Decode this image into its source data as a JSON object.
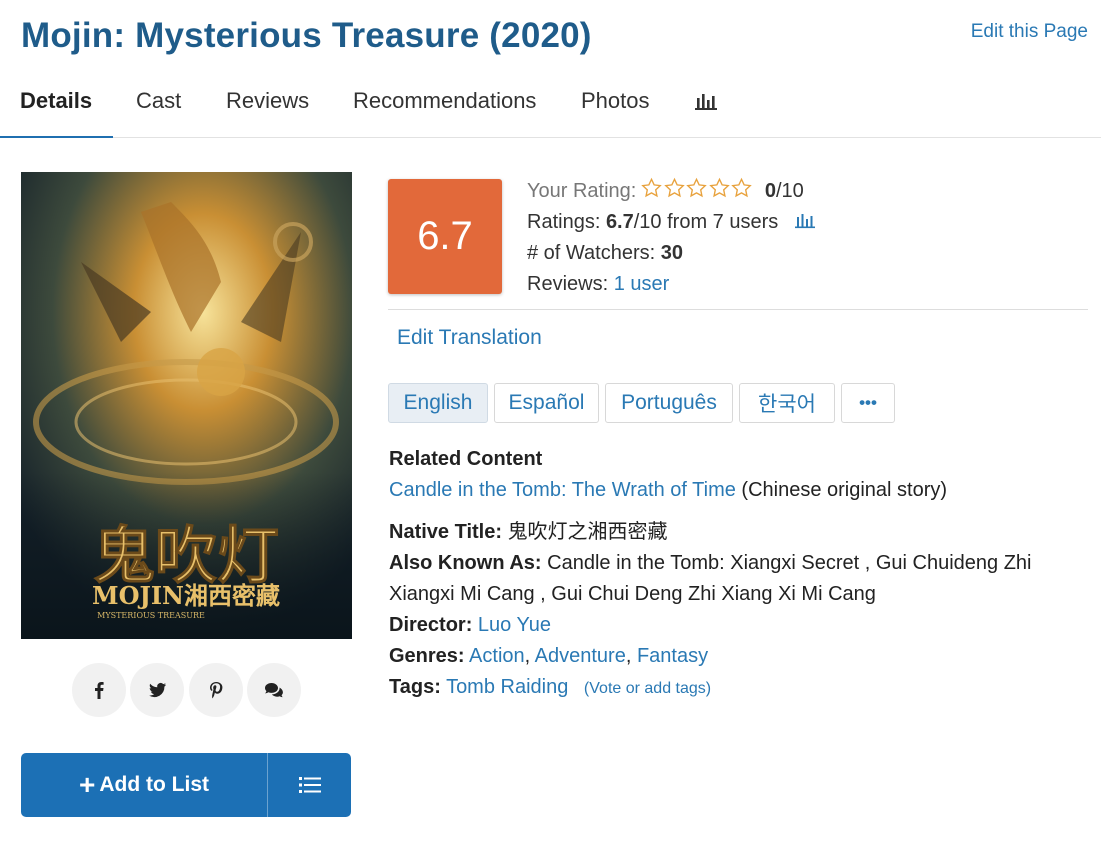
{
  "header": {
    "title": "Mojin: Mysterious Treasure (2020)",
    "edit_page": "Edit this Page"
  },
  "tabs": [
    {
      "label": "Details",
      "active": true
    },
    {
      "label": "Cast"
    },
    {
      "label": "Reviews"
    },
    {
      "label": "Recommendations"
    },
    {
      "label": "Photos"
    }
  ],
  "tabs_extra_icon": "bar-chart-icon",
  "poster": {
    "text_main": "鬼吹灯",
    "text_sub": "MOJIN湘西密藏",
    "text_small": "MYSTERIOUS TREASURE"
  },
  "share_icons": [
    "facebook-icon",
    "twitter-icon",
    "pinterest-icon",
    "comments-icon"
  ],
  "add_list": {
    "label": "Add to List",
    "icon": "list-icon"
  },
  "score": "6.7",
  "rating": {
    "your_label": "Your Rating:",
    "your_value": "0",
    "your_max": "/10",
    "stars_count": 5,
    "ratings_label": "Ratings:",
    "ratings_value": "6.7",
    "ratings_suffix": "/10 from 7 users",
    "watchers_label": "# of Watchers:",
    "watchers_value": "30",
    "reviews_label": "Reviews:",
    "reviews_value": "1 user"
  },
  "edit_translation": "Edit Translation",
  "languages": [
    {
      "label": "English",
      "active": true
    },
    {
      "label": "Español"
    },
    {
      "label": "Português"
    },
    {
      "label": "한국어"
    },
    {
      "label": "•••"
    }
  ],
  "details": {
    "related_label": "Related Content",
    "related_link": "Candle in the Tomb: The Wrath of Time",
    "related_note": "(Chinese original story)",
    "native_label": "Native Title:",
    "native_value": "鬼吹灯之湘西密藏",
    "aka_label": "Also Known As:",
    "aka_line1": "Candle in the Tomb: Xiangxi Secret , Gui Chuideng Zhi",
    "aka_line2": "Xiangxi Mi Cang , Gui Chui Deng Zhi Xiang Xi Mi Cang",
    "director_label": "Director:",
    "director_value": "Luo Yue",
    "genres_label": "Genres:",
    "genres": [
      "Action",
      "Adventure",
      "Fantasy"
    ],
    "tags_label": "Tags:",
    "tag": "Tomb Raiding",
    "tags_vote": "(Vote or add tags)"
  },
  "colors": {
    "title": "#1f5c8a",
    "link": "#2a79b4",
    "score_bg": "#e2693a",
    "button_bg": "#1c70b5"
  }
}
